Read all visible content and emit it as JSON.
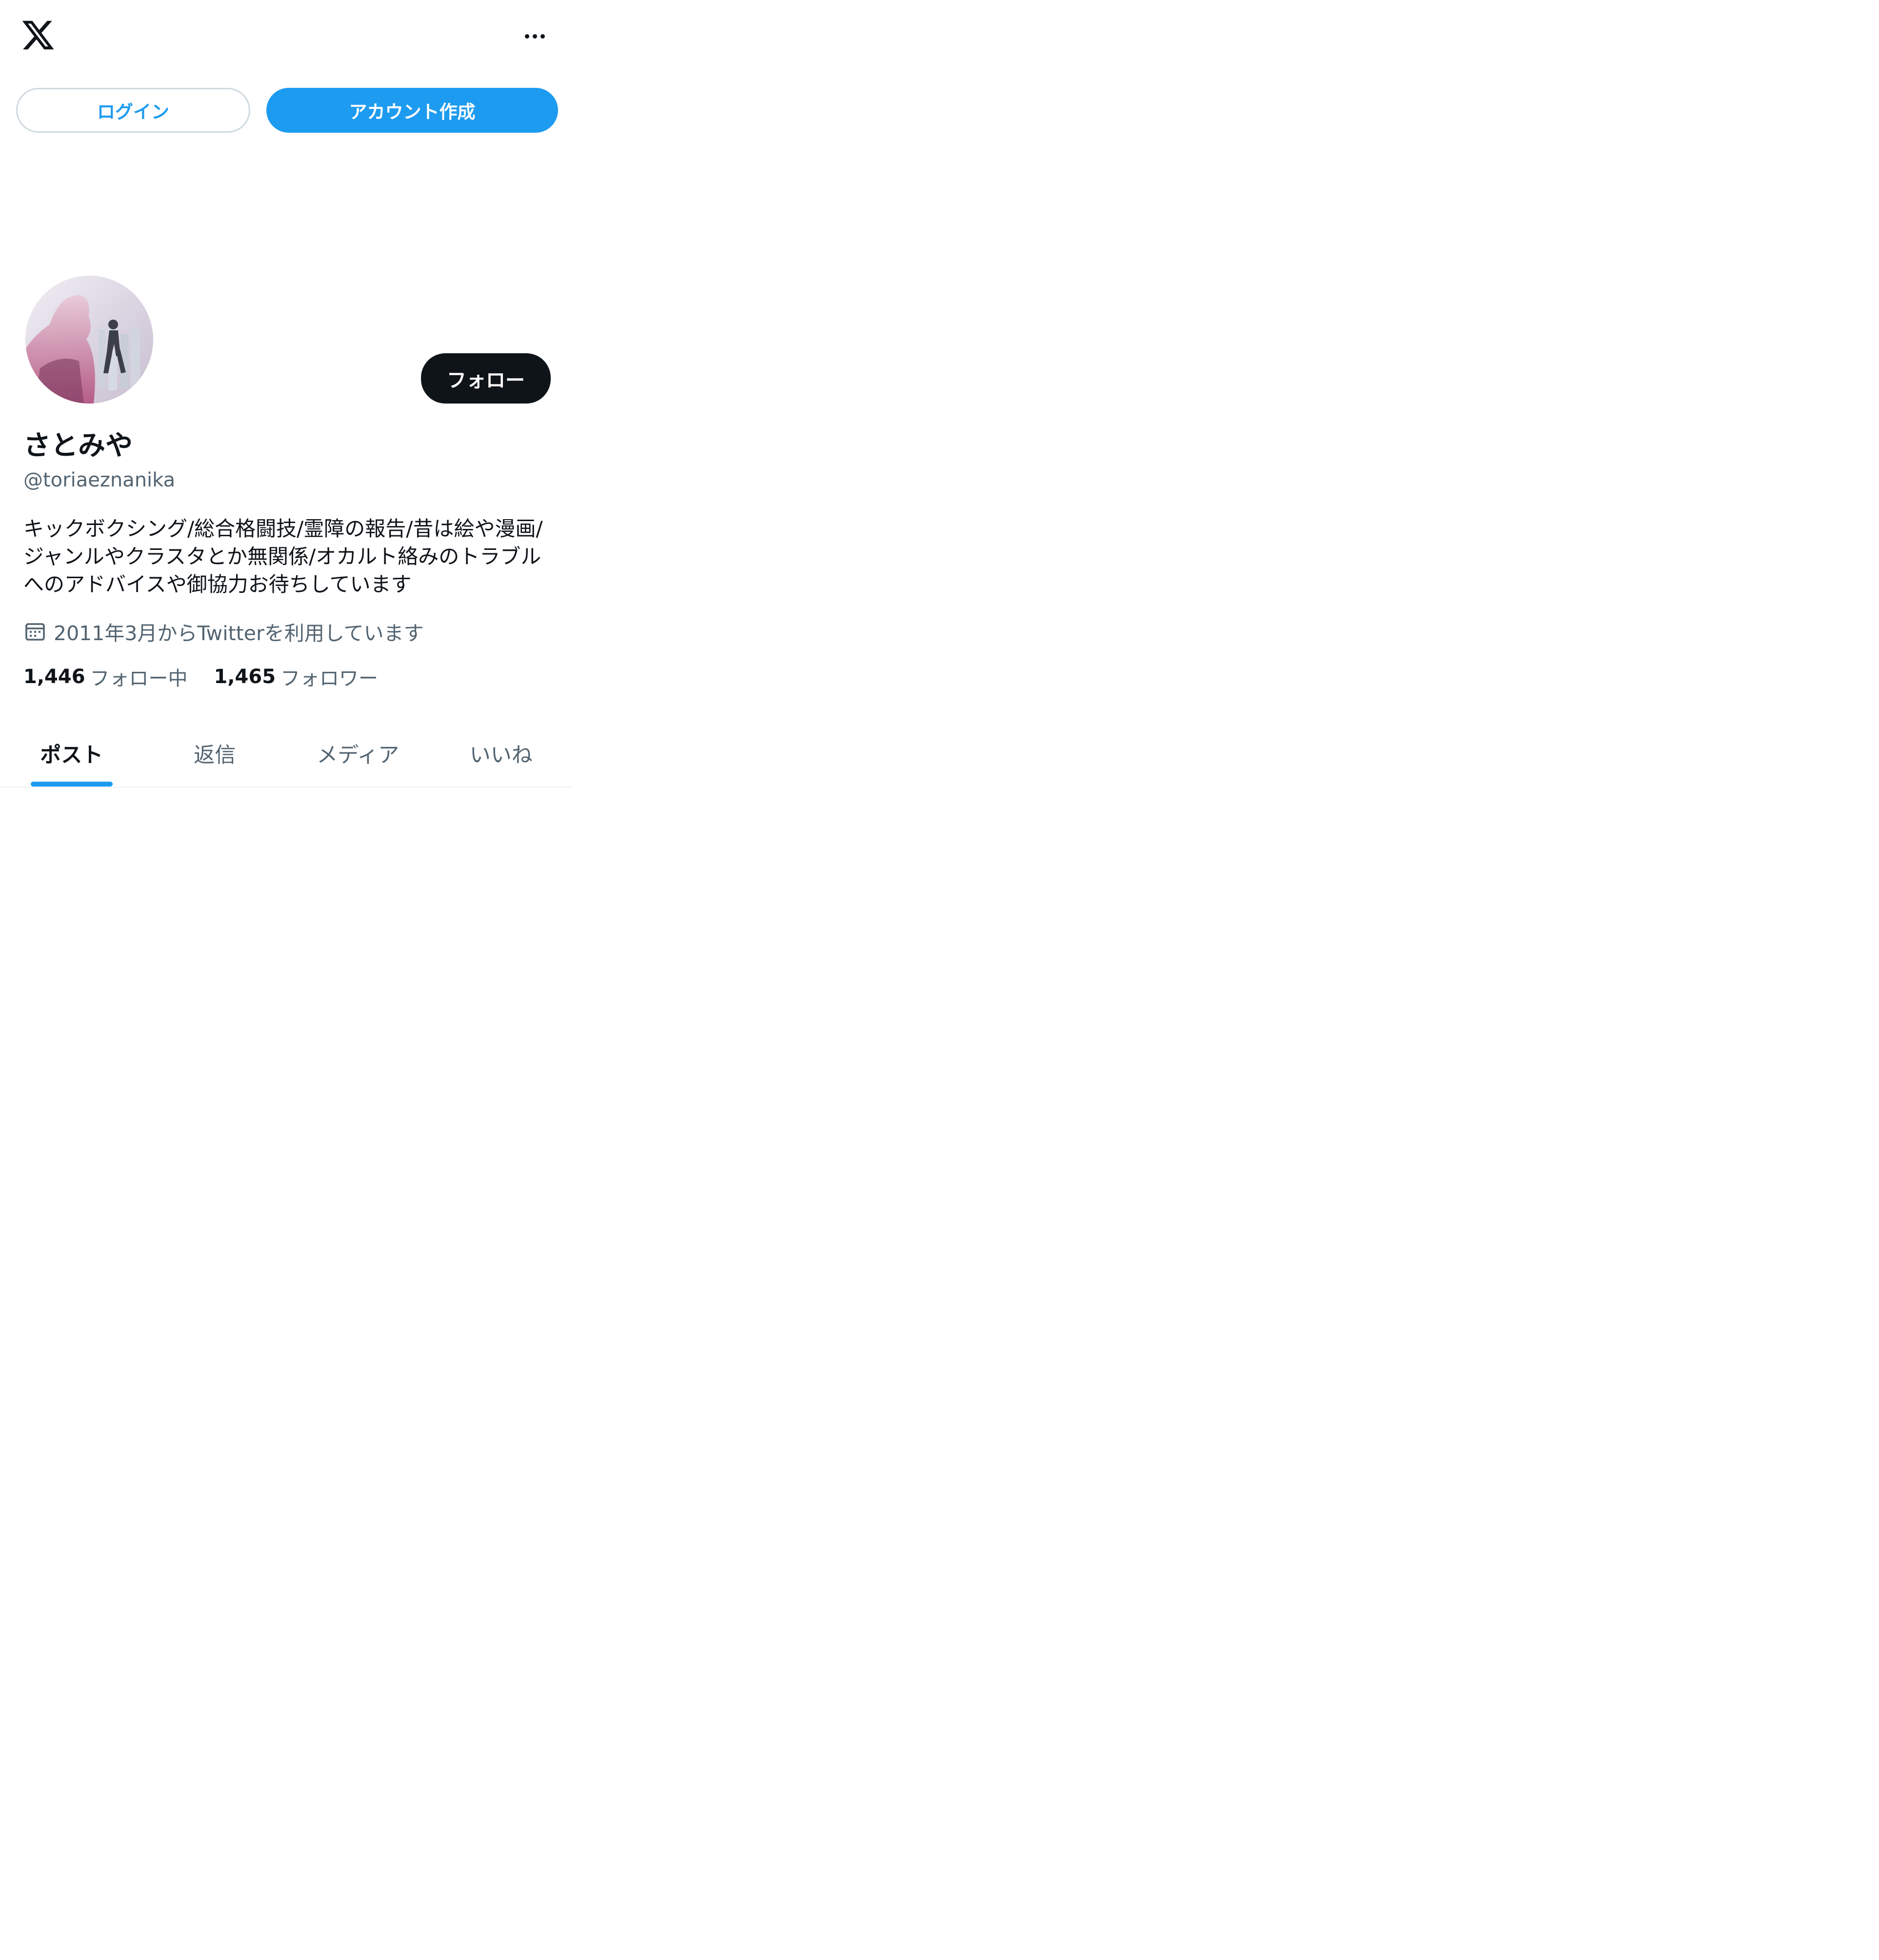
{
  "header": {
    "logo_icon": "x-logo-icon",
    "more_icon": "more-horizontal-icon"
  },
  "auth": {
    "login_label": "ログイン",
    "signup_label": "アカウント作成"
  },
  "profile": {
    "display_name": "さとみや",
    "handle": "@toriaeznanika",
    "follow_label": "フォロー",
    "bio_lines": [
      "キックボクシング/総合格闘技/霊障の報告/昔は絵や漫画/",
      "ジャンルやクラスタとか無関係/オカルト絡みのトラブル",
      "へのアドバイスや御協力お待ちしています"
    ],
    "joined": "2011年3月からTwitterを利用しています",
    "joined_icon": "calendar-icon",
    "following_count": "1,446",
    "following_label": "フォロー中",
    "followers_count": "1,465",
    "followers_label": "フォロワー"
  },
  "tabs": [
    {
      "label": "ポスト",
      "active": true
    },
    {
      "label": "返信",
      "active": false
    },
    {
      "label": "メディア",
      "active": false
    },
    {
      "label": "いいね",
      "active": false
    }
  ],
  "colors": {
    "accent": "#1d9bf0",
    "text_primary": "#0f1419",
    "text_secondary": "#536471",
    "border": "#cfd9de",
    "divider": "#eff3f4",
    "follow_button": "#0f1419"
  }
}
